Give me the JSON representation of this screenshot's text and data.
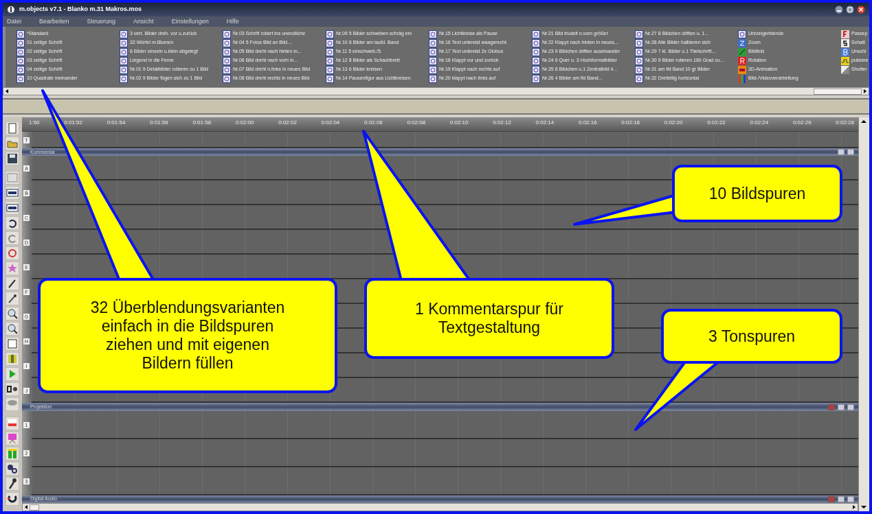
{
  "window": {
    "title": "m.objects v7.1 - Blanko m.31 Makros.mos",
    "menu": [
      "Datei",
      "Bearbeiten",
      "Steuerung",
      "Ansicht",
      "Einstellungen",
      "Hilfe"
    ]
  },
  "transitions": {
    "columns": [
      {
        "items": [
          {
            "label": "*Standard",
            "kind": "transition"
          },
          {
            "label": "01 zeilige Schrift",
            "kind": "transition"
          },
          {
            "label": "02 zeilige Schrift",
            "kind": "transition"
          },
          {
            "label": "03 zeilige Schrift",
            "kind": "transition"
          },
          {
            "label": "04 zeilige Schrift",
            "kind": "transition"
          },
          {
            "label": "10 Quadrate ineinander",
            "kind": "transition"
          }
        ]
      },
      {
        "items": [
          {
            "label": "3 vert. Bilder dreh. vor u.zurück",
            "kind": "transition"
          },
          {
            "label": "32 Würfel m.Blumen",
            "kind": "transition"
          },
          {
            "label": "6 Bilder  einzeln u.klein abgelegt",
            "kind": "transition"
          },
          {
            "label": "Liegend in die Ferne",
            "kind": "transition"
          },
          {
            "label": "Nr.01  9 Detailbilder rotieren zu 1 Bild",
            "kind": "transition"
          },
          {
            "label": "Nr.02  9 Bilder fügen sich zu 1 Bild",
            "kind": "transition"
          }
        ]
      },
      {
        "items": [
          {
            "label": "Nr.03 Schrift rotiert ins unendliche",
            "kind": "transition"
          },
          {
            "label": "Nr.04  5 Fotos Bild an Bild....",
            "kind": "transition"
          },
          {
            "label": "Nr.05  Bild dreht nach hinten in...",
            "kind": "transition"
          },
          {
            "label": "Nr.06  Bild dreht nach vorn in...",
            "kind": "transition"
          },
          {
            "label": "Nr.07 Bild dreht n.links in neues Bild",
            "kind": "transition"
          },
          {
            "label": "Nr.08 Bild dreht rechts in neues Bild",
            "kind": "transition"
          }
        ]
      },
      {
        "items": [
          {
            "label": "Nr.09  5 Bilder schweben schräg ein",
            "kind": "transition"
          },
          {
            "label": "Nr.10  8 Bilder am laufd. Band",
            "kind": "transition"
          },
          {
            "label": "Nr.11  5 einschweb./5.",
            "kind": "transition"
          },
          {
            "label": "Nr.12  8 Bilder als Schachbrett",
            "kind": "transition"
          },
          {
            "label": "Nr.13  6 Bilder kreisen",
            "kind": "transition"
          },
          {
            "label": "Nr.14 Pausenfigur aus Lichtkreisen",
            "kind": "transition"
          }
        ]
      },
      {
        "items": [
          {
            "label": "Nr.15 Lichtkreise als Pause",
            "kind": "transition"
          },
          {
            "label": "Nr.16 Text umkreist waagerecht",
            "kind": "transition"
          },
          {
            "label": "Nr.17 Text umkreist 2x Globus",
            "kind": "transition"
          },
          {
            "label": "Nr.18 Klappt vor und zurück",
            "kind": "transition"
          },
          {
            "label": "Nr.19 Klappt nach rechts auf",
            "kind": "transition"
          },
          {
            "label": "Nr.20 klappt nach links auf",
            "kind": "transition"
          }
        ]
      },
      {
        "items": [
          {
            "label": "Nr.21 Bild trudelt n.vorn größer",
            "kind": "transition"
          },
          {
            "label": "Nr.22 Klappt nach hinten in neues...",
            "kind": "transition"
          },
          {
            "label": "Nr.23  9 Bildchen driften auseinander",
            "kind": "transition"
          },
          {
            "label": "Nr.24  6 Quer u. 3 Hochformatbilder",
            "kind": "transition"
          },
          {
            "label": "Nr.25  8 Bildchen u.1 Zentralbild 4...",
            "kind": "transition"
          },
          {
            "label": "Nr.26 4 Bilder am lfd Band...",
            "kind": "transition"
          }
        ]
      },
      {
        "items": [
          {
            "label": "Nr.27  8 Bildchen driften u. 1...",
            "kind": "transition"
          },
          {
            "label": "Nr.28  Alle Bilder halbieren sich",
            "kind": "transition"
          },
          {
            "label": "Nr.29  7 kl. Bilder u.1 Titelschrift...",
            "kind": "transition"
          },
          {
            "label": "Nr.30  9 Bilder rotieren 180 Grad zu...",
            "kind": "transition"
          },
          {
            "label": "Nr.31 am lfd Band 10 gr Bilder",
            "kind": "transition"
          },
          {
            "label": "Nr.32 Dreiteilig horizontal",
            "kind": "transition"
          }
        ]
      },
      {
        "items": [
          {
            "label": "Uhrzeigerblende",
            "kind": "transition"
          },
          {
            "label": "Zoom",
            "kind": "zoom"
          },
          {
            "label": "Bildfeld",
            "kind": "field"
          },
          {
            "label": "Rotation",
            "kind": "rotation"
          },
          {
            "label": "3D-Animation",
            "kind": "animation"
          },
          {
            "label": "Bild-/Videoverarbeitung",
            "kind": "bars"
          }
        ]
      },
      {
        "items": [
          {
            "label": "Passep",
            "kind": "frame"
          },
          {
            "label": "Schatt",
            "kind": "shadow"
          },
          {
            "label": "Unschi",
            "kind": "blur"
          },
          {
            "label": "pulsiere",
            "kind": "pulse"
          },
          {
            "label": "Shutter",
            "kind": "shutter"
          }
        ]
      }
    ]
  },
  "timeline": {
    "ruler": [
      "1:50",
      "0:01:52",
      "0:01:54",
      "0:01:56",
      "0:01:58",
      "0:02:00",
      "0:02:02",
      "0:02:04",
      "0:02:06",
      "0:02:08",
      "0:02:10",
      "0:02:12",
      "0:02:14",
      "0:02:16",
      "0:02:18",
      "0:02:20",
      "0:02:22",
      "0:02:24",
      "0:02:26",
      "0:02:28"
    ],
    "comment_track": {
      "marker": "T",
      "header": "Kommentar"
    },
    "image_tracks": [
      "A",
      "B",
      "C",
      "D",
      "E",
      "F",
      "G",
      "H",
      "I",
      "J"
    ],
    "projection_header": "Projektion",
    "audio_tracks": [
      "1",
      "2",
      "3"
    ],
    "audio_header": "Digital Audio"
  },
  "callouts": [
    {
      "text": "32 Überblendungsvarianten einfach in die Bildspuren ziehen und mit eigenen Bildern füllen"
    },
    {
      "text": "1 Kommentarspur für Textgestaltung"
    },
    {
      "text": "10 Bildspuren"
    },
    {
      "text": "3 Tonspuren"
    }
  ]
}
